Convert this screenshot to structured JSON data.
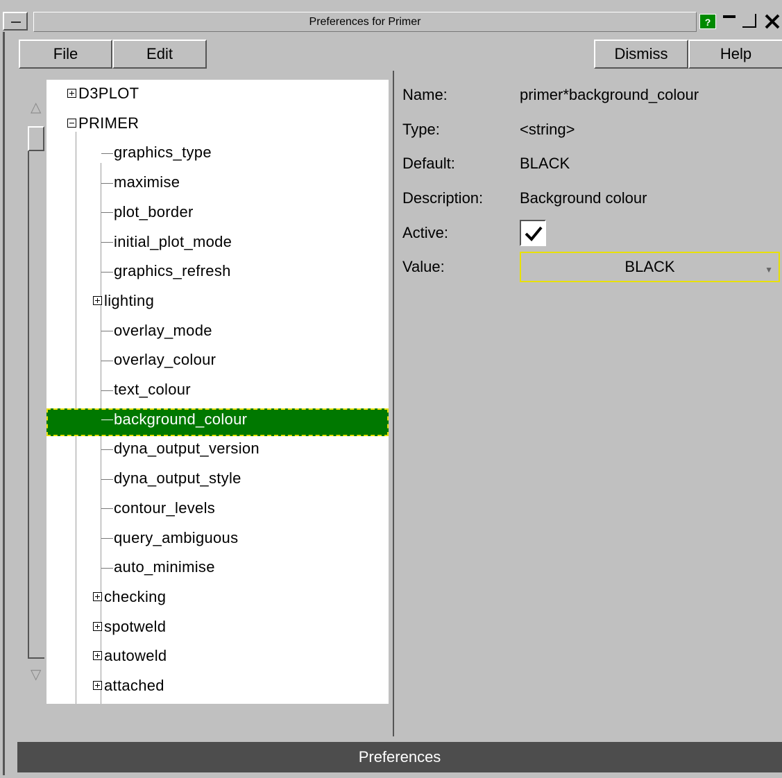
{
  "window": {
    "title": "Preferences for Primer",
    "help_glyph": "?",
    "close_glyph": "✕"
  },
  "menubar": {
    "file": "File",
    "edit": "Edit",
    "dismiss": "Dismiss",
    "help": "Help"
  },
  "tree": {
    "roots": [
      {
        "label": "D3PLOT",
        "expanded": false
      },
      {
        "label": "PRIMER",
        "expanded": true
      }
    ],
    "primer_children": [
      {
        "label": "graphics_type",
        "type": "leaf"
      },
      {
        "label": "maximise",
        "type": "leaf"
      },
      {
        "label": "plot_border",
        "type": "leaf"
      },
      {
        "label": "initial_plot_mode",
        "type": "leaf"
      },
      {
        "label": "graphics_refresh",
        "type": "leaf"
      },
      {
        "label": "lighting",
        "type": "group"
      },
      {
        "label": "overlay_mode",
        "type": "leaf"
      },
      {
        "label": "overlay_colour",
        "type": "leaf"
      },
      {
        "label": "text_colour",
        "type": "leaf"
      },
      {
        "label": "background_colour",
        "type": "leaf",
        "selected": true
      },
      {
        "label": "dyna_output_version",
        "type": "leaf"
      },
      {
        "label": "dyna_output_style",
        "type": "leaf"
      },
      {
        "label": "contour_levels",
        "type": "leaf"
      },
      {
        "label": "query_ambiguous",
        "type": "leaf"
      },
      {
        "label": "auto_minimise",
        "type": "leaf"
      },
      {
        "label": "checking",
        "type": "group"
      },
      {
        "label": "spotweld",
        "type": "group"
      },
      {
        "label": "autoweld",
        "type": "group"
      },
      {
        "label": "attached",
        "type": "group"
      }
    ]
  },
  "details": {
    "name_label": "Name:",
    "name_value": "primer*background_colour",
    "type_label": "Type:",
    "type_value": "<string>",
    "default_label": "Default:",
    "default_value": "BLACK",
    "description_label": "Description:",
    "description_value": "Background colour",
    "active_label": "Active:",
    "active_checked": true,
    "value_label": "Value:",
    "value_selected": "BLACK"
  },
  "footer": {
    "label": "Preferences"
  },
  "colors": {
    "background": "#c0c0c0",
    "selection": "#007800",
    "selection_border": "#e8e000",
    "help_button": "#008a00",
    "footer": "#4d4d4d"
  }
}
